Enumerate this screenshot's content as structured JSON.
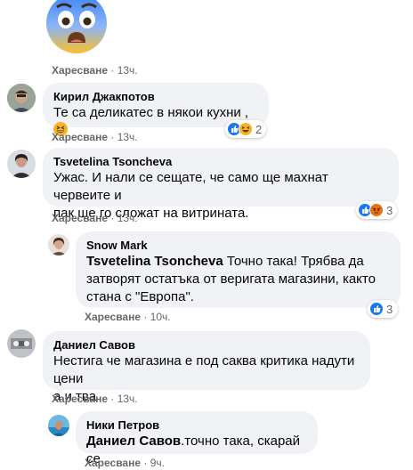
{
  "top_emoji": {
    "icon": "fearful-face-emoji"
  },
  "comments": [
    {
      "actions": {
        "like": "Харесване",
        "sep": " · ",
        "time": "13ч."
      }
    },
    {
      "author": "Кирил Джакпотов",
      "text": "Те са деликатес в някои кухни ,",
      "trailing_emoji": "grinning-squinting-face-emoji",
      "reactions": {
        "icons": [
          "like",
          "haha"
        ],
        "count": "2"
      },
      "actions": {
        "like": "Харесване",
        "sep": " · ",
        "time": "13ч."
      }
    },
    {
      "author": "Tsvetelina Tsoncheva",
      "text_line1": "Ужас. И нали се сещате, че само ще махнат червеите и",
      "text_line2": "пак ще го сложат на витрината.",
      "reactions": {
        "icons": [
          "like",
          "angry"
        ],
        "count": "3"
      },
      "actions": {
        "like": "Харесване",
        "sep": " · ",
        "time": "13ч."
      }
    },
    {
      "author": "Snow Mark",
      "mention": "Tsvetelina Tsoncheva",
      "text_line1": " Точно така! Трябва да",
      "text_line2": "затворят остатъка от веригата магазини, както",
      "text_line3": "стана с \"Европа\".",
      "reactions": {
        "icons": [
          "like"
        ],
        "count": "3"
      },
      "actions": {
        "like": "Харесване",
        "sep": " · ",
        "time": "10ч."
      }
    },
    {
      "author": "Даниел Савов",
      "text_line1": "Нестига че магазина е под саква критика надути цени",
      "text_line2": "а и тва",
      "actions": {
        "like": "Харесване",
        "sep": " · ",
        "time": "13ч."
      }
    },
    {
      "author": "Ники Петров",
      "mention": "Даниел Савов",
      "text": ".точно така, скарай се",
      "actions": {
        "like": "Харесване",
        "sep": " · ",
        "time": "9ч."
      }
    }
  ],
  "colors": {
    "bubble": "#f0f2f5",
    "meta_text": "#65676b",
    "like_blue": "#1877f2",
    "haha_yellow": "#f7b125",
    "angry_orange": "#e9710f"
  }
}
